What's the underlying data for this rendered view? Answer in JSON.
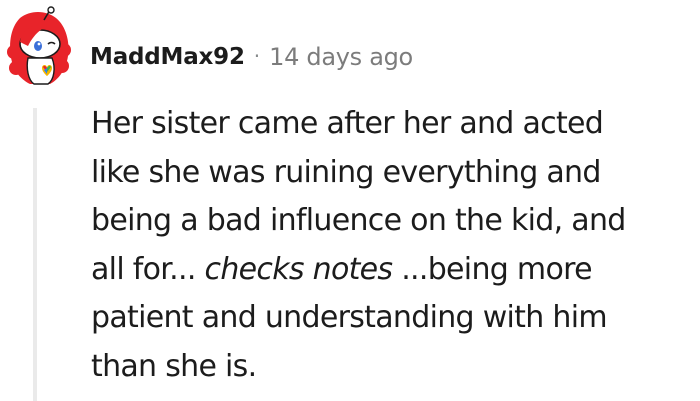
{
  "comment": {
    "username": "MaddMax92",
    "separator": "·",
    "timestamp": "14 days ago",
    "avatar_icon": "snoo-avatar-icon",
    "body": {
      "line1": "Her sister came after her and acted",
      "line2": "like she was ruining everything and",
      "line3": "being a bad influence on the kid, and",
      "line4_pre": "all for... ",
      "line4_em": "checks notes",
      "line4_post": " ...being more",
      "line5": "patient and understanding with him",
      "line6": "than she is."
    }
  },
  "colors": {
    "text": "#1c1c1c",
    "meta": "#7c7c7c",
    "thread_line": "#eaeaea",
    "avatar_hair": "#e8242a",
    "avatar_face": "#ffffff"
  }
}
